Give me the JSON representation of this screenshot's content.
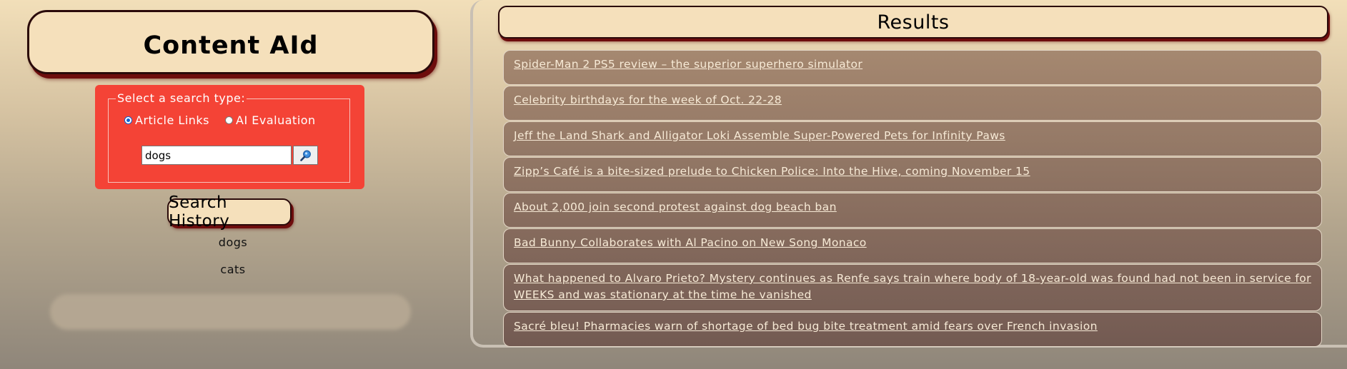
{
  "app": {
    "title": "Content AId"
  },
  "search": {
    "legend": "Select a search type:",
    "options": [
      {
        "label": "Article Links",
        "checked": true
      },
      {
        "label": "AI Evaluation",
        "checked": false
      }
    ],
    "query": "dogs",
    "submit_icon": "magnifier-icon"
  },
  "history": {
    "button_label": "Search History",
    "items": [
      "dogs",
      "cats"
    ]
  },
  "results": {
    "title": "Results",
    "items": [
      "Spider-Man 2 PS5 review – the superior superhero simulator",
      "Celebrity birthdays for the week of Oct. 22-28",
      "Jeff the Land Shark and Alligator Loki Assemble Super-Powered Pets for Infinity Paws",
      "Zipp’s Café is a bite-sized prelude to Chicken Police: Into the Hive, coming November 15",
      "About 2,000 join second protest against dog beach ban",
      "Bad Bunny Collaborates with Al Pacino on New Song Monaco",
      "What happened to Alvaro Prieto? Mystery continues as Renfe says train where body of 18-year-old was found had not been in service for WEEKS and was stationary at the time he vanished",
      "Sacré bleu! Pharmacies warn of shortage of bed bug bite treatment amid fears over French invasion"
    ]
  },
  "colors": {
    "panel_red": "#f44336",
    "cream": "#f5e0bb",
    "card_top": "#a58870",
    "card_bottom": "#735a52",
    "link": "#f7ead6"
  }
}
